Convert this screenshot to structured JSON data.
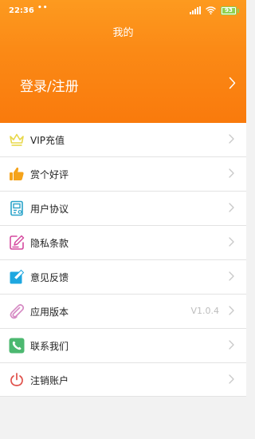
{
  "status_bar": {
    "time": "22:36",
    "dots": "••",
    "battery": "93"
  },
  "header": {
    "title": "我的",
    "login_label": "登录/注册"
  },
  "menu": {
    "items": [
      {
        "label": "VIP充值",
        "icon": "crown-icon"
      },
      {
        "label": "赏个好评",
        "icon": "thumbs-up-icon"
      },
      {
        "label": "用户协议",
        "icon": "document-icon"
      },
      {
        "label": "隐私条款",
        "icon": "edit-note-icon"
      },
      {
        "label": "意见反馈",
        "icon": "feedback-pencil-icon"
      },
      {
        "label": "应用版本",
        "icon": "paperclip-icon",
        "value": "V1.0.4"
      },
      {
        "label": "联系我们",
        "icon": "phone-icon"
      },
      {
        "label": "注销账户",
        "icon": "power-icon"
      }
    ]
  },
  "colors": {
    "header_top": "#fd9a1f",
    "header_bottom": "#f97a0c",
    "crown": "#e8d84a",
    "thumb": "#f5a31a",
    "document": "#2aa3c9",
    "edit_note": "#d64ba0",
    "feedback": "#1ea7e0",
    "paperclip": "#d68bc4",
    "phone": "#4cb870",
    "power": "#e0504a"
  }
}
